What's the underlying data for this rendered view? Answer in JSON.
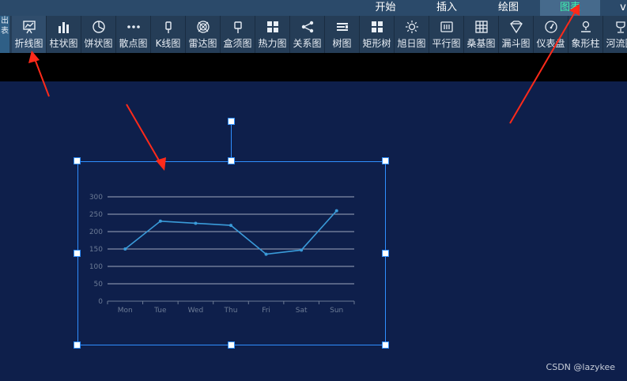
{
  "menu": {
    "tabs": [
      {
        "label": "开始"
      },
      {
        "label": "插入"
      },
      {
        "label": "绘图"
      },
      {
        "label": "图表"
      },
      {
        "label": "v"
      }
    ],
    "active_tab": "图表"
  },
  "toolbar": {
    "side_label": "出表",
    "tools": [
      {
        "label": "折线图",
        "icon": "line-chart-icon"
      },
      {
        "label": "柱状图",
        "icon": "bar-chart-icon"
      },
      {
        "label": "饼状图",
        "icon": "pie-chart-icon"
      },
      {
        "label": "散点图",
        "icon": "scatter-chart-icon"
      },
      {
        "label": "K线图",
        "icon": "candlestick-icon"
      },
      {
        "label": "雷达图",
        "icon": "radar-icon"
      },
      {
        "label": "盒须图",
        "icon": "boxplot-icon"
      },
      {
        "label": "热力图",
        "icon": "heatmap-icon"
      },
      {
        "label": "关系图",
        "icon": "graph-icon"
      },
      {
        "label": "树图",
        "icon": "tree-icon"
      },
      {
        "label": "矩形树",
        "icon": "treemap-icon"
      },
      {
        "label": "旭日图",
        "icon": "sunburst-icon"
      },
      {
        "label": "平行图",
        "icon": "parallel-icon"
      },
      {
        "label": "桑基图",
        "icon": "sankey-icon"
      },
      {
        "label": "漏斗图",
        "icon": "funnel-icon"
      },
      {
        "label": "仪表盘",
        "icon": "gauge-icon"
      },
      {
        "label": "象形柱",
        "icon": "pictorial-bar-icon"
      },
      {
        "label": "河流图",
        "icon": "theme-river-icon"
      }
    ]
  },
  "colors": {
    "accent": "#2f8fff",
    "active_tab_text": "#3ff0b0",
    "line": "#3a9bd9",
    "arrow": "#ff2a1a"
  },
  "chart_data": {
    "type": "line",
    "categories": [
      "Mon",
      "Tue",
      "Wed",
      "Thu",
      "Fri",
      "Sat",
      "Sun"
    ],
    "values": [
      150,
      230,
      224,
      218,
      135,
      147,
      260
    ],
    "ylim": [
      0,
      300
    ],
    "yticks": [
      0,
      50,
      100,
      150,
      200,
      250,
      300
    ],
    "grid": true,
    "title": "",
    "xlabel": "",
    "ylabel": ""
  },
  "watermark": "CSDN @lazykee"
}
